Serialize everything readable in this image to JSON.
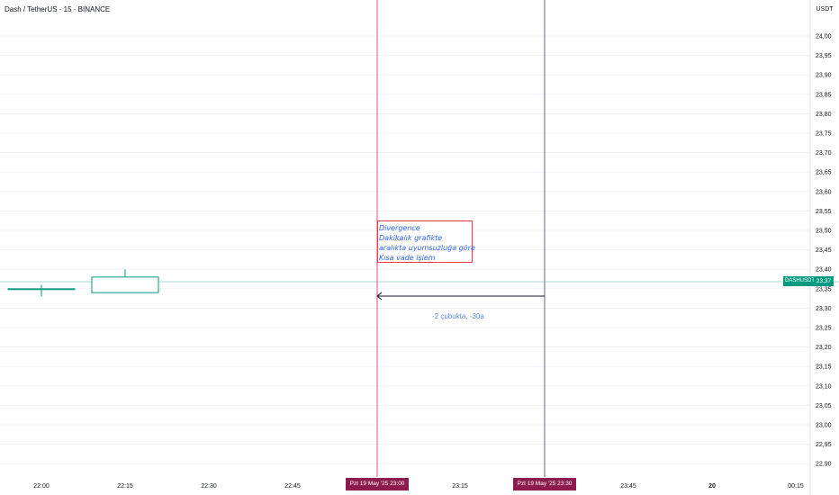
{
  "header": {
    "title": "Dash / TetherUS · 15 · BINANCE",
    "currency": "USDT"
  },
  "price_axis": {
    "ticks": [
      "24,00",
      "23,95",
      "23,90",
      "23,85",
      "23,80",
      "23,75",
      "23,70",
      "23,65",
      "23,60",
      "23,55",
      "23,50",
      "23,45",
      "23,40",
      "23,35",
      "23,30",
      "23,25",
      "23,20",
      "23,15",
      "23,10",
      "23,05",
      "23,00",
      "22,95",
      "22,90"
    ],
    "symbol_label": "DASHUSDT",
    "last_price_label": "23,37",
    "last_price": 23.37
  },
  "time_axis": {
    "ticks": [
      "22:00",
      "22:15",
      "22:30",
      "22:45",
      "23:15",
      "23:45",
      "20",
      "00:15"
    ],
    "highlight_start": "Pzt 19 May '25   23:00",
    "highlight_end": "Pzt 19 May '25   23:30"
  },
  "drawings": {
    "note_lines": [
      "Divergence",
      "Dakikalık grafikte",
      "aralıkta uyumsuzluğa göre",
      "Kısa vade işlem"
    ],
    "measure_label": "-2 çubukta, -30a"
  },
  "colors": {
    "up": "#089981",
    "down": "#f23645",
    "text_blue": "#2962ff",
    "date_tag_bg": "#8c1b4f"
  },
  "chart_data": {
    "type": "candlestick",
    "symbol": "DASHUSDT",
    "interval": "15",
    "exchange": "BINANCE",
    "ylim": [
      22.875,
      24.03
    ],
    "candles": [
      {
        "time": "22:00",
        "open": 23.35,
        "high": 23.36,
        "low": 23.33,
        "close": 23.35
      },
      {
        "time": "22:15",
        "open": 23.34,
        "high": 23.4,
        "low": 23.34,
        "close": 23.38
      }
    ],
    "last_price": 23.37
  }
}
